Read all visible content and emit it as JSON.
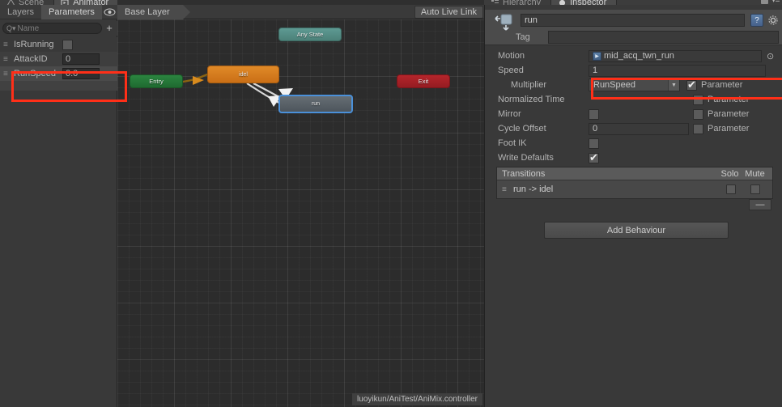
{
  "window_tabs": {
    "left": [
      {
        "label": "Scene",
        "icon": "scene-icon",
        "active": false
      },
      {
        "label": "Animator",
        "icon": "animator-icon",
        "active": true
      }
    ],
    "right": [
      {
        "label": "Hierarchy",
        "icon": "hierarchy-icon",
        "active": false
      },
      {
        "label": "Inspector",
        "icon": "inspector-icon",
        "active": true
      }
    ]
  },
  "parameters_panel": {
    "tabs": [
      {
        "label": "Layers",
        "active": false
      },
      {
        "label": "Parameters",
        "active": true
      }
    ],
    "eye_icon": "eye-icon",
    "search": {
      "placeholder": "Name",
      "value": "",
      "icon": "search-icon"
    },
    "add_button": "+",
    "items": [
      {
        "name": "IsRunning",
        "type": "bool",
        "value": "",
        "checked": false,
        "selected": false
      },
      {
        "name": "AttackID",
        "type": "int",
        "value": "0",
        "selected": false
      },
      {
        "name": "RunSpeed",
        "type": "float",
        "value": "0.0",
        "selected": true
      }
    ],
    "highlight_color": "#ff2f18"
  },
  "animator": {
    "breadcrumb": "Base Layer",
    "auto_live_link": "Auto Live Link",
    "controller_path": "luoyikun/AniTest/AniMix.controller",
    "nodes": [
      {
        "id": "anystate",
        "label": "Any State",
        "color": "#4c8179"
      },
      {
        "id": "entry",
        "label": "Entry",
        "color": "#1f6a30"
      },
      {
        "id": "idel",
        "label": "idel",
        "color": "#ca6f16"
      },
      {
        "id": "run",
        "label": "run",
        "color": "#4d555c",
        "selected": true
      },
      {
        "id": "exit",
        "label": "Exit",
        "color": "#951c22"
      }
    ]
  },
  "inspector": {
    "name": "run",
    "tag_label": "Tag",
    "tag_value": "",
    "help_icon": "help-icon",
    "gear_icon": "gear-icon",
    "lock_icon": "lock-icon",
    "menu_icon": "menu-icon",
    "state_icon": "animator-state-icon",
    "fields": {
      "motion": {
        "label": "Motion",
        "value": "mid_acq_twn_run",
        "icon": "animation-clip-icon",
        "picker": "object-picker-icon"
      },
      "speed": {
        "label": "Speed",
        "value": "1"
      },
      "multiplier": {
        "label": "Multiplier",
        "value": "RunSpeed",
        "param_label": "Parameter",
        "param_checked": true,
        "highlighted": true
      },
      "normalized_time": {
        "label": "Normalized Time",
        "value": "",
        "param_label": "Parameter",
        "param_checked": false
      },
      "mirror": {
        "label": "Mirror",
        "checked": false,
        "param_label": "Parameter",
        "param_checked": false
      },
      "cycle_offset": {
        "label": "Cycle Offset",
        "value": "0",
        "param_label": "Parameter",
        "param_checked": false
      },
      "foot_ik": {
        "label": "Foot IK",
        "checked": false
      },
      "write_defaults": {
        "label": "Write Defaults",
        "checked": true
      }
    },
    "transitions": {
      "title": "Transitions",
      "solo_label": "Solo",
      "mute_label": "Mute",
      "rows": [
        {
          "name": "run -> idel",
          "solo": false,
          "mute": false
        }
      ],
      "remove_button": "—"
    },
    "add_behaviour": "Add Behaviour",
    "highlight_color": "#ff2f18"
  }
}
